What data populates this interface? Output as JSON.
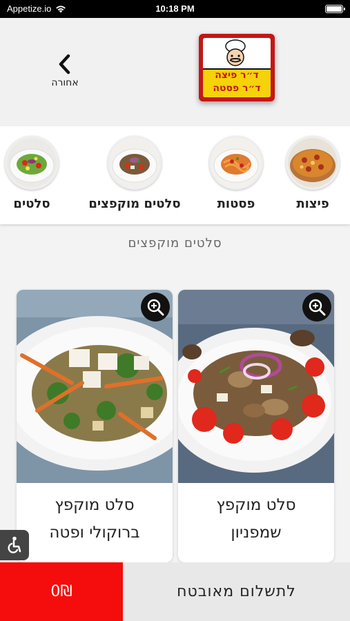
{
  "status_bar": {
    "carrier": "Appetize.io",
    "time": "10:18 PM"
  },
  "header": {
    "back_label": "אחורה",
    "logo_line1": "ד״ר פיצה",
    "logo_line2": "ד״ר פסטה"
  },
  "categories": [
    {
      "label": "פיצות"
    },
    {
      "label": "פסטות"
    },
    {
      "label": "סלטים מוקפצים"
    },
    {
      "label": "סלטים"
    }
  ],
  "section_title": "סלטים מוקפצים",
  "products": [
    {
      "title_line1": "סלט מוקפץ",
      "title_line2": "שמפניון"
    },
    {
      "title_line1": "סלט מוקפץ",
      "title_line2": "ברוקולי ופטה"
    }
  ],
  "footer": {
    "secure_pay_label": "לתשלום מאובטח",
    "cart_total": "0₪"
  },
  "colors": {
    "accent": "#f50d0d",
    "logo_red": "#c41616",
    "logo_yellow": "#f5d20a"
  }
}
